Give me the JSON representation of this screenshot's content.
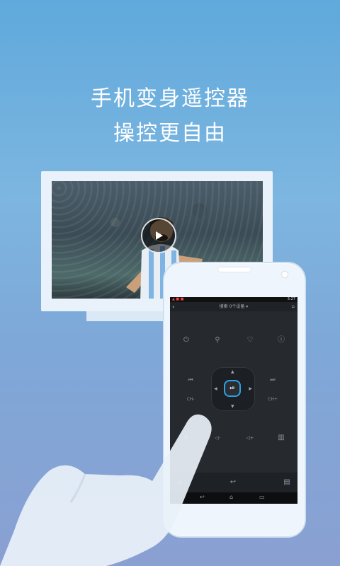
{
  "headline": {
    "line1": "手机变身遥控器",
    "line2": "操控更自由"
  },
  "tv": {
    "video": "soccer-player-celebration",
    "play_icon": "play-icon"
  },
  "phone_screen": {
    "status_time": "3:27",
    "status_left": "▲ ■ ■",
    "title": "搜索 0个设备 ▾",
    "back_icon": "‹",
    "right_icon": "⌂",
    "remote_buttons": {
      "power": "⏻",
      "search": "⚲",
      "favorite": "♡",
      "info": "ⓘ",
      "prev": "⏮",
      "next": "⏭",
      "channel_minus": "CH-",
      "channel_plus": "CH+",
      "mute": "✕",
      "vol_down": "◁-",
      "vol_up": "◁+",
      "menu": "▥",
      "play_pause": "⏯",
      "home": "⌂",
      "return": "↩",
      "list": "▤"
    },
    "navbar": {
      "back": "↩",
      "home": "⌂",
      "recent": "▭"
    }
  },
  "colors": {
    "background_top": "#5fa9dc",
    "background_bottom": "#8aa0d2",
    "accent": "#2da3e6",
    "remote_bg": "#26292d"
  }
}
